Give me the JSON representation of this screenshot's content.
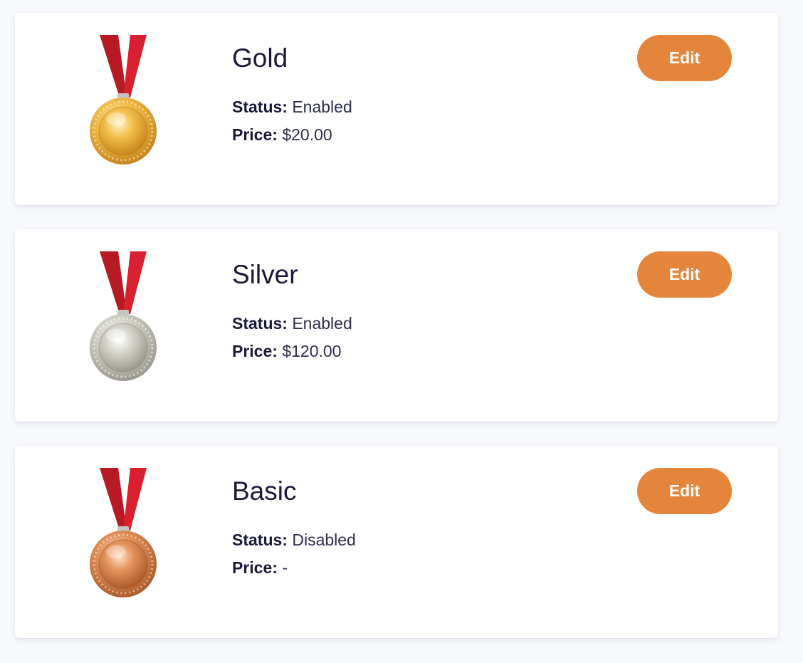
{
  "plans": [
    {
      "name": "Gold",
      "status_label": "Status:",
      "status_value": "Enabled",
      "price_label": "Price:",
      "price_value": "$20.00",
      "edit_label": "Edit",
      "medal_icon": "gold-medal-icon",
      "medal_colors": [
        "#fff4c8",
        "#f2bd4a",
        "#c8861c"
      ]
    },
    {
      "name": "Silver",
      "status_label": "Status:",
      "status_value": "Enabled",
      "price_label": "Price:",
      "price_value": "$120.00",
      "edit_label": "Edit",
      "medal_icon": "silver-medal-icon",
      "medal_colors": [
        "#ffffff",
        "#d2d1c8",
        "#9c9a90"
      ]
    },
    {
      "name": "Basic",
      "status_label": "Status:",
      "status_value": "Disabled",
      "price_label": "Price:",
      "price_value": "-",
      "edit_label": "Edit",
      "medal_icon": "bronze-medal-icon",
      "medal_colors": [
        "#ffe2c8",
        "#e3915a",
        "#ad5d2c"
      ]
    }
  ],
  "colors": {
    "accent": "#e5843b",
    "text": "#1b1a3c",
    "ribbon": "#cf1f2c"
  }
}
